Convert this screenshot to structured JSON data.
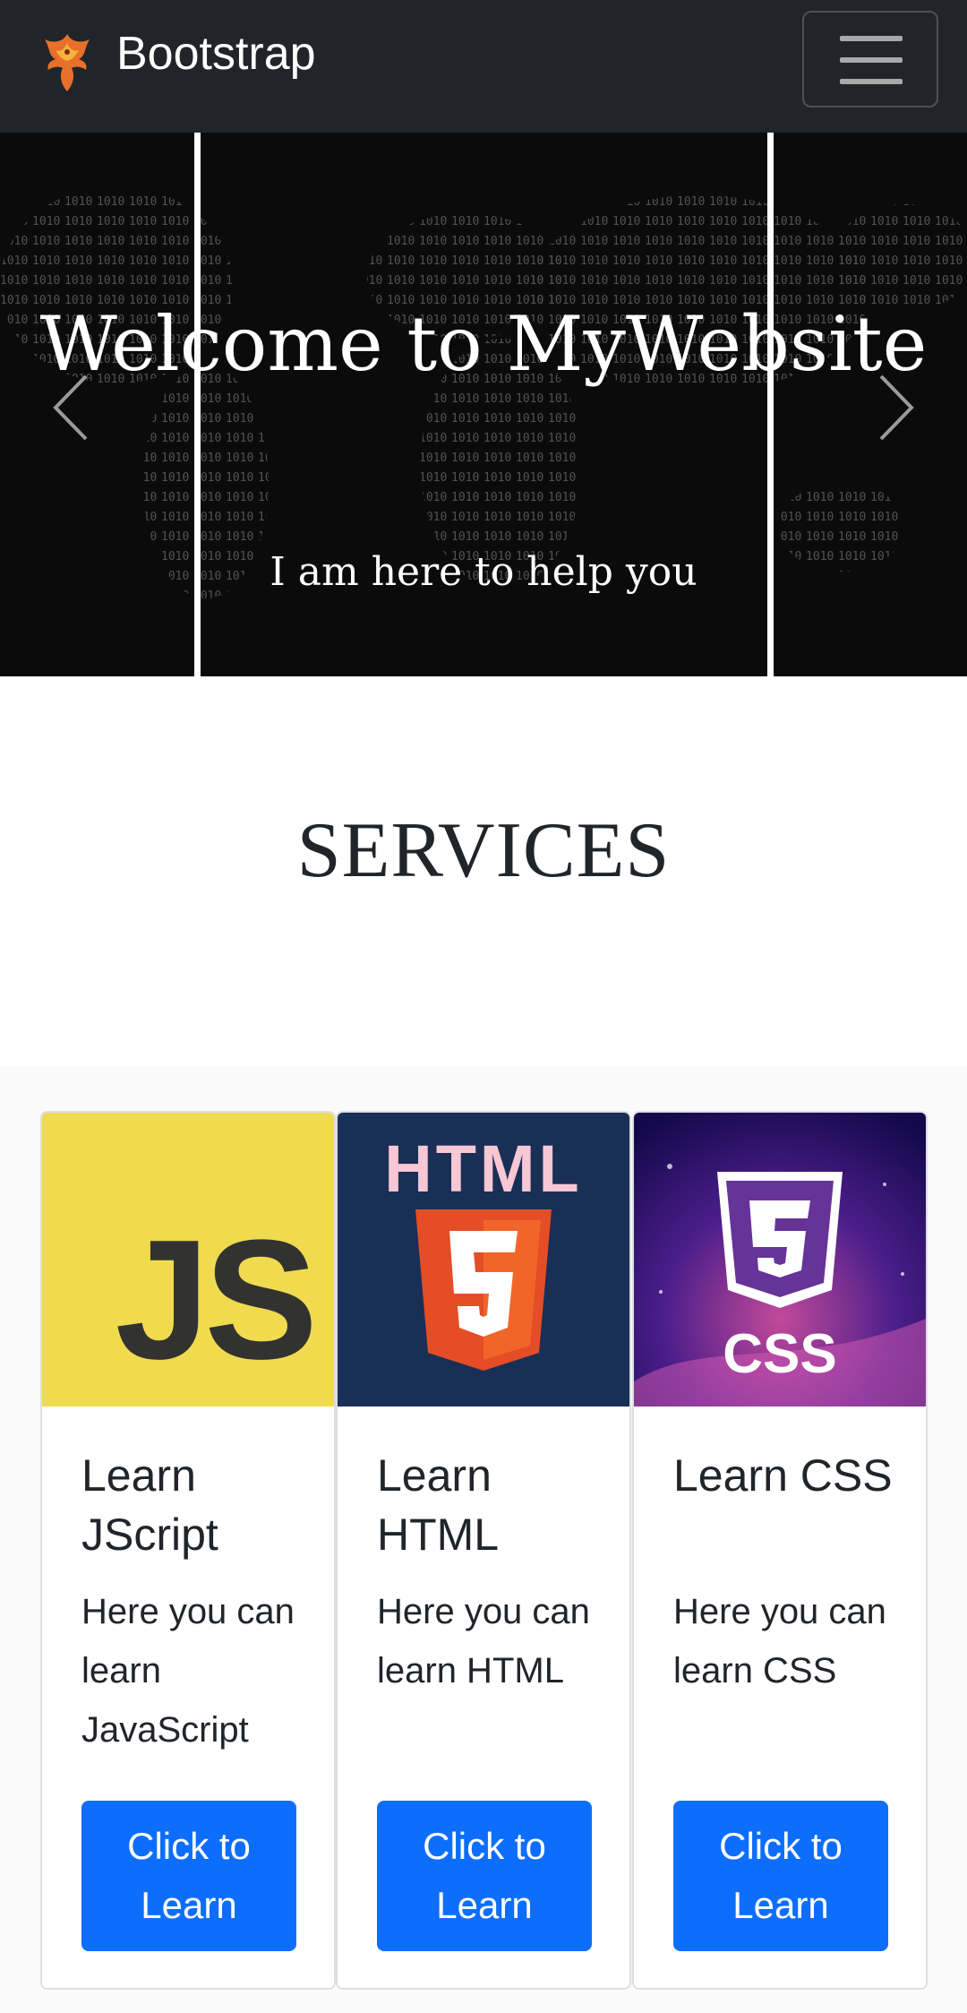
{
  "navbar": {
    "brand_text": "Bootstrap",
    "brand_logo": "phoenix-logo",
    "toggler_icon": "hamburger-menu-icon"
  },
  "carousel": {
    "title": "Welcome to MyWebsite",
    "caption": "I am here to help you",
    "prev_icon": "chevron-left-icon",
    "next_icon": "chevron-right-icon"
  },
  "services": {
    "heading": "SERVICES",
    "cards": [
      {
        "image": "javascript-logo",
        "image_text": "JS",
        "title": "Learn JScript",
        "text": "Here you can learn JavaScript",
        "button": "Click to Learn"
      },
      {
        "image": "html5-logo",
        "image_text": "HTML",
        "title": "Learn HTML",
        "text": "Here you can learn HTML",
        "button": "Click to Learn"
      },
      {
        "image": "css3-logo",
        "image_text": "CSS",
        "title": "Learn CSS",
        "text": "Here you can learn CSS",
        "button": "Click to Learn"
      }
    ]
  },
  "colors": {
    "navbar_bg": "#212529",
    "button_primary": "#0d6efd",
    "js_yellow": "#f0db4f",
    "html_navy": "#1a2f56",
    "html_orange": "#e44d26",
    "css_purple": "#663399"
  }
}
